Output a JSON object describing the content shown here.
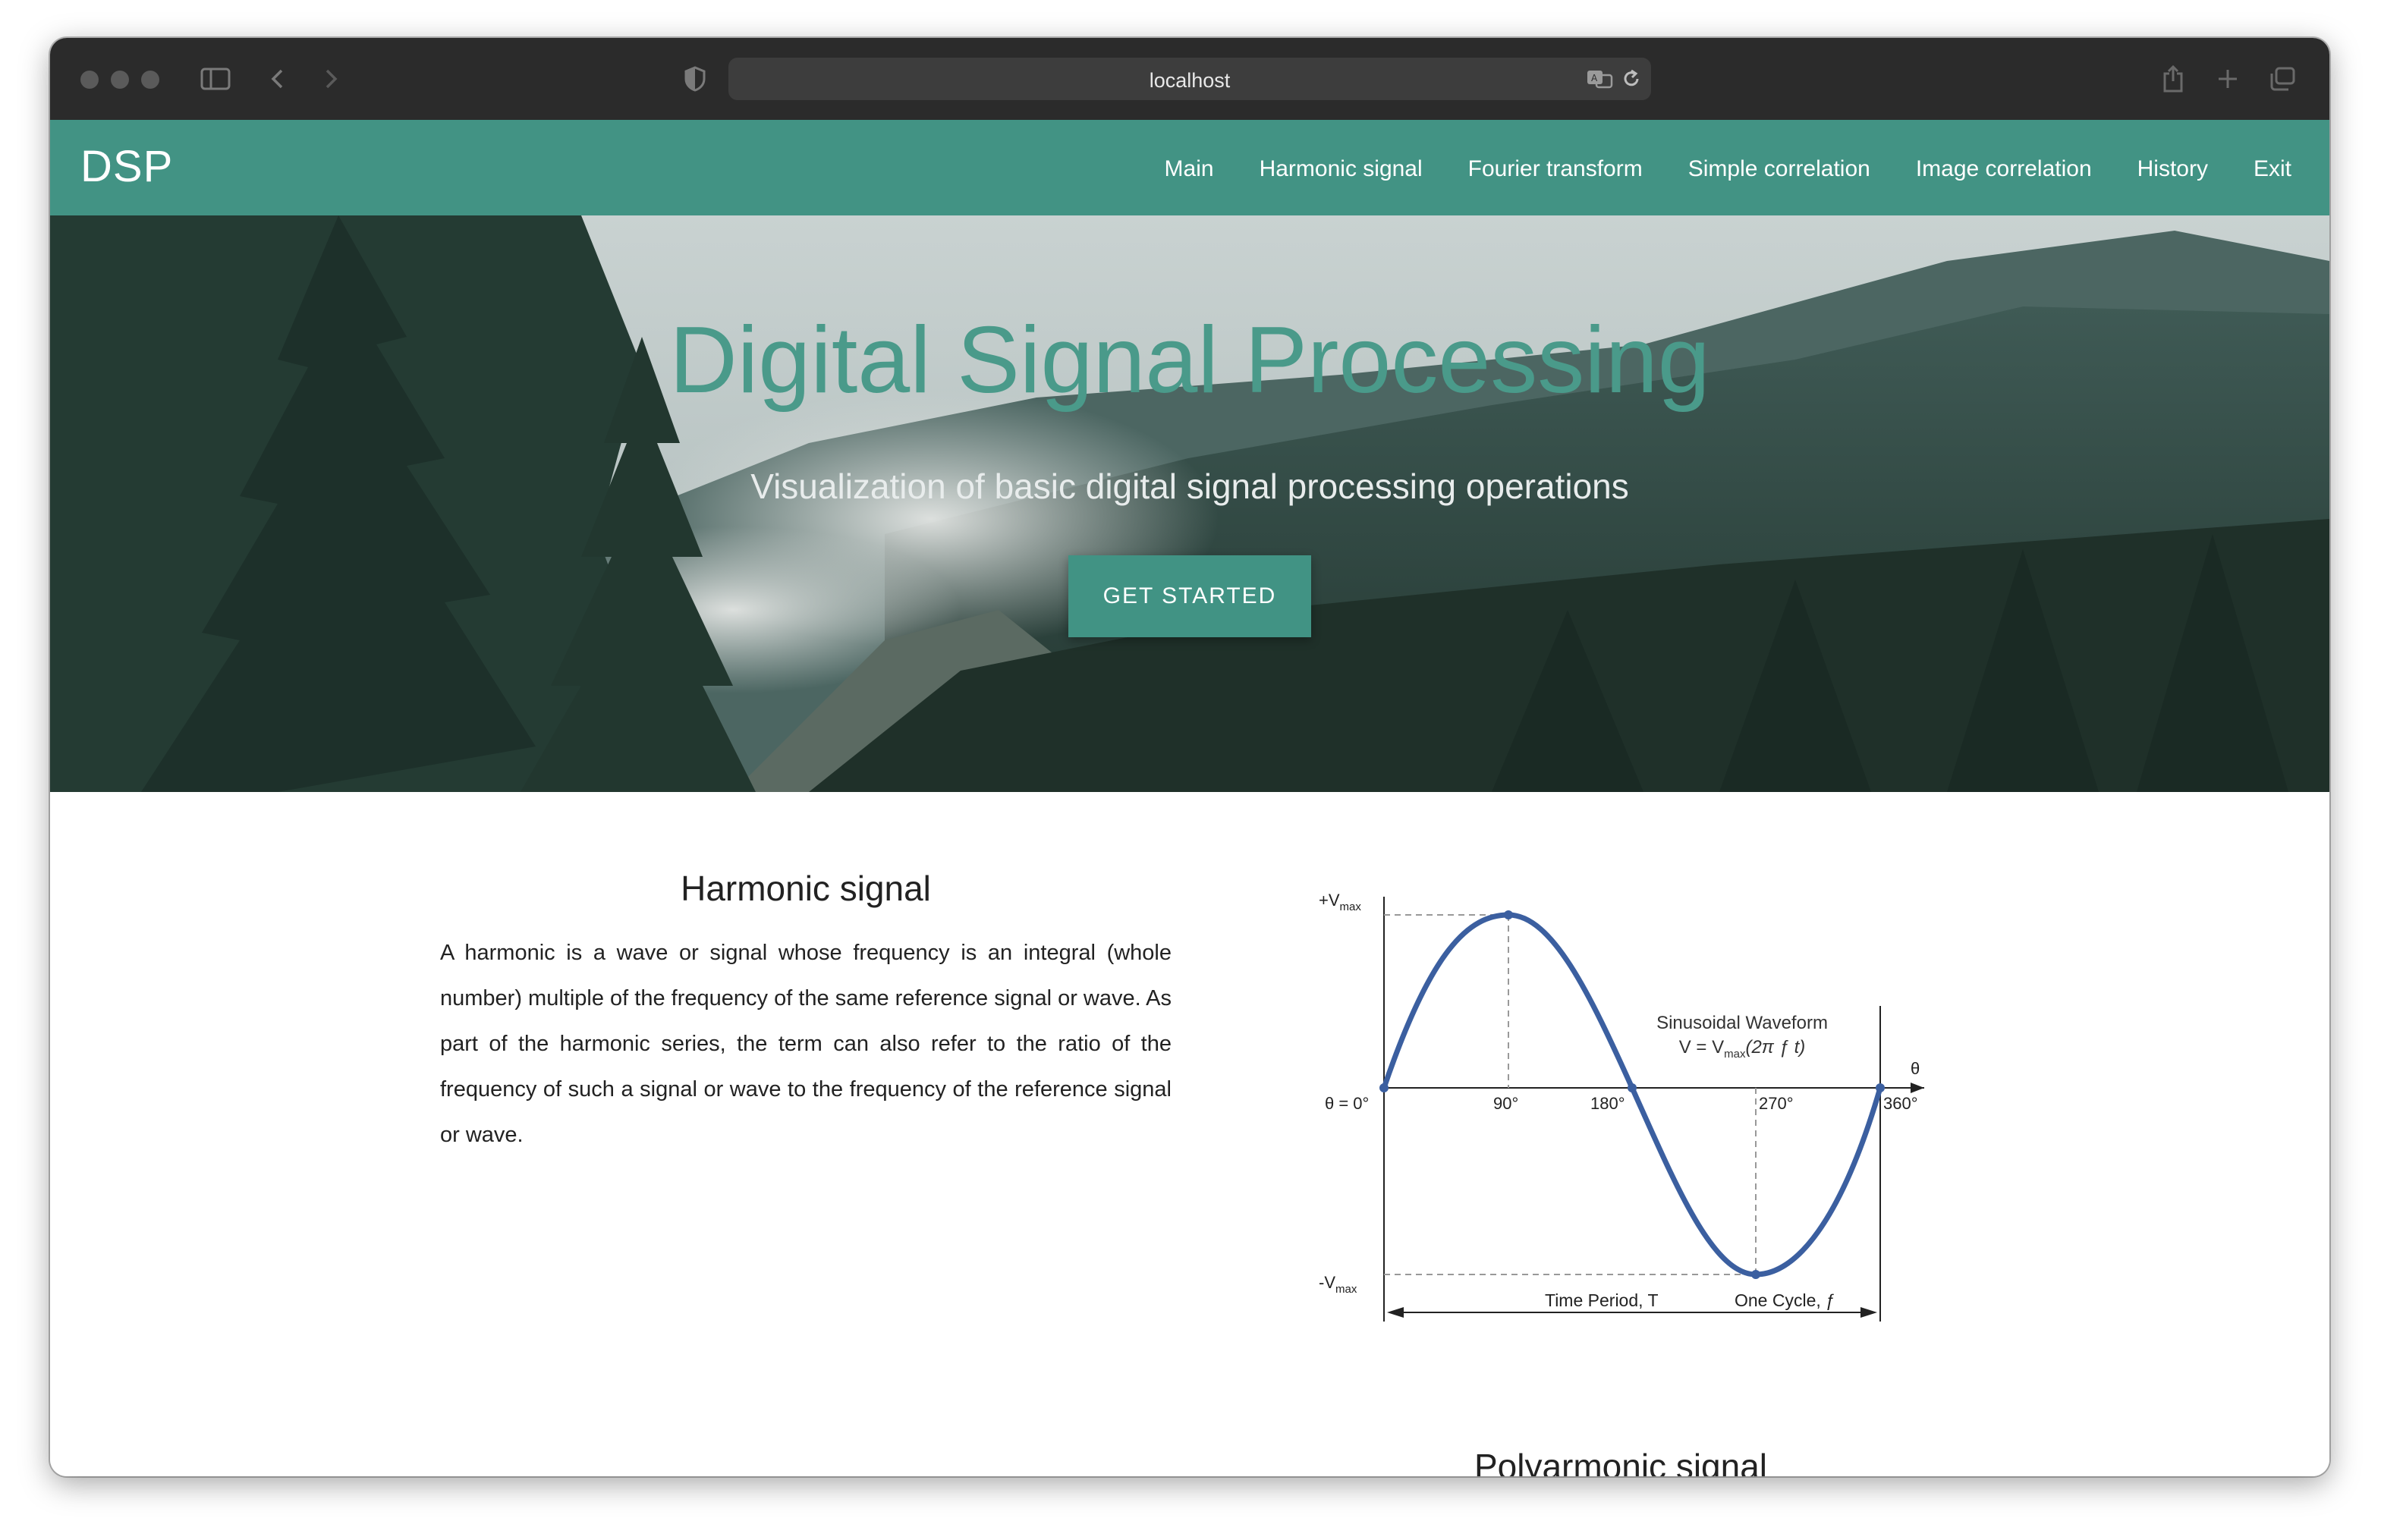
{
  "browser": {
    "url": "localhost"
  },
  "nav": {
    "brand": "DSP",
    "links": [
      "Main",
      "Harmonic signal",
      "Fourier transform",
      "Simple correlation",
      "Image correlation",
      "History",
      "Exit"
    ]
  },
  "hero": {
    "title": "Digital Signal Processing",
    "subtitle": "Visualization of basic digital signal processing operations",
    "button": "GET STARTED"
  },
  "section": {
    "title": "Harmonic signal",
    "text": "A harmonic is a wave or signal whose frequency is an integral (whole number) multiple of the frequency of the same reference signal or wave. As part of the harmonic series, the term can also refer to the ratio of the frequency of such a signal or wave to the frequency of the reference signal or wave."
  },
  "diagram": {
    "vmax_label": "+V",
    "vmin_label": "-V",
    "max_sub": "max",
    "theta0": "θ = 0°",
    "deg90": "90°",
    "deg180": "180°",
    "deg270": "270°",
    "deg360": "360°",
    "theta": "θ",
    "wave_title": "Sinusoidal Waveform",
    "formula_pre": "V = V",
    "formula_post": "(2π ƒ t)",
    "period": "Time Period, T",
    "cycle": "One Cycle, ƒ"
  },
  "next_section": {
    "title": "Polyarmonic signal"
  },
  "colors": {
    "nav": "#429384",
    "title": "#4a9a8a",
    "wave": "#3b5fa0"
  }
}
